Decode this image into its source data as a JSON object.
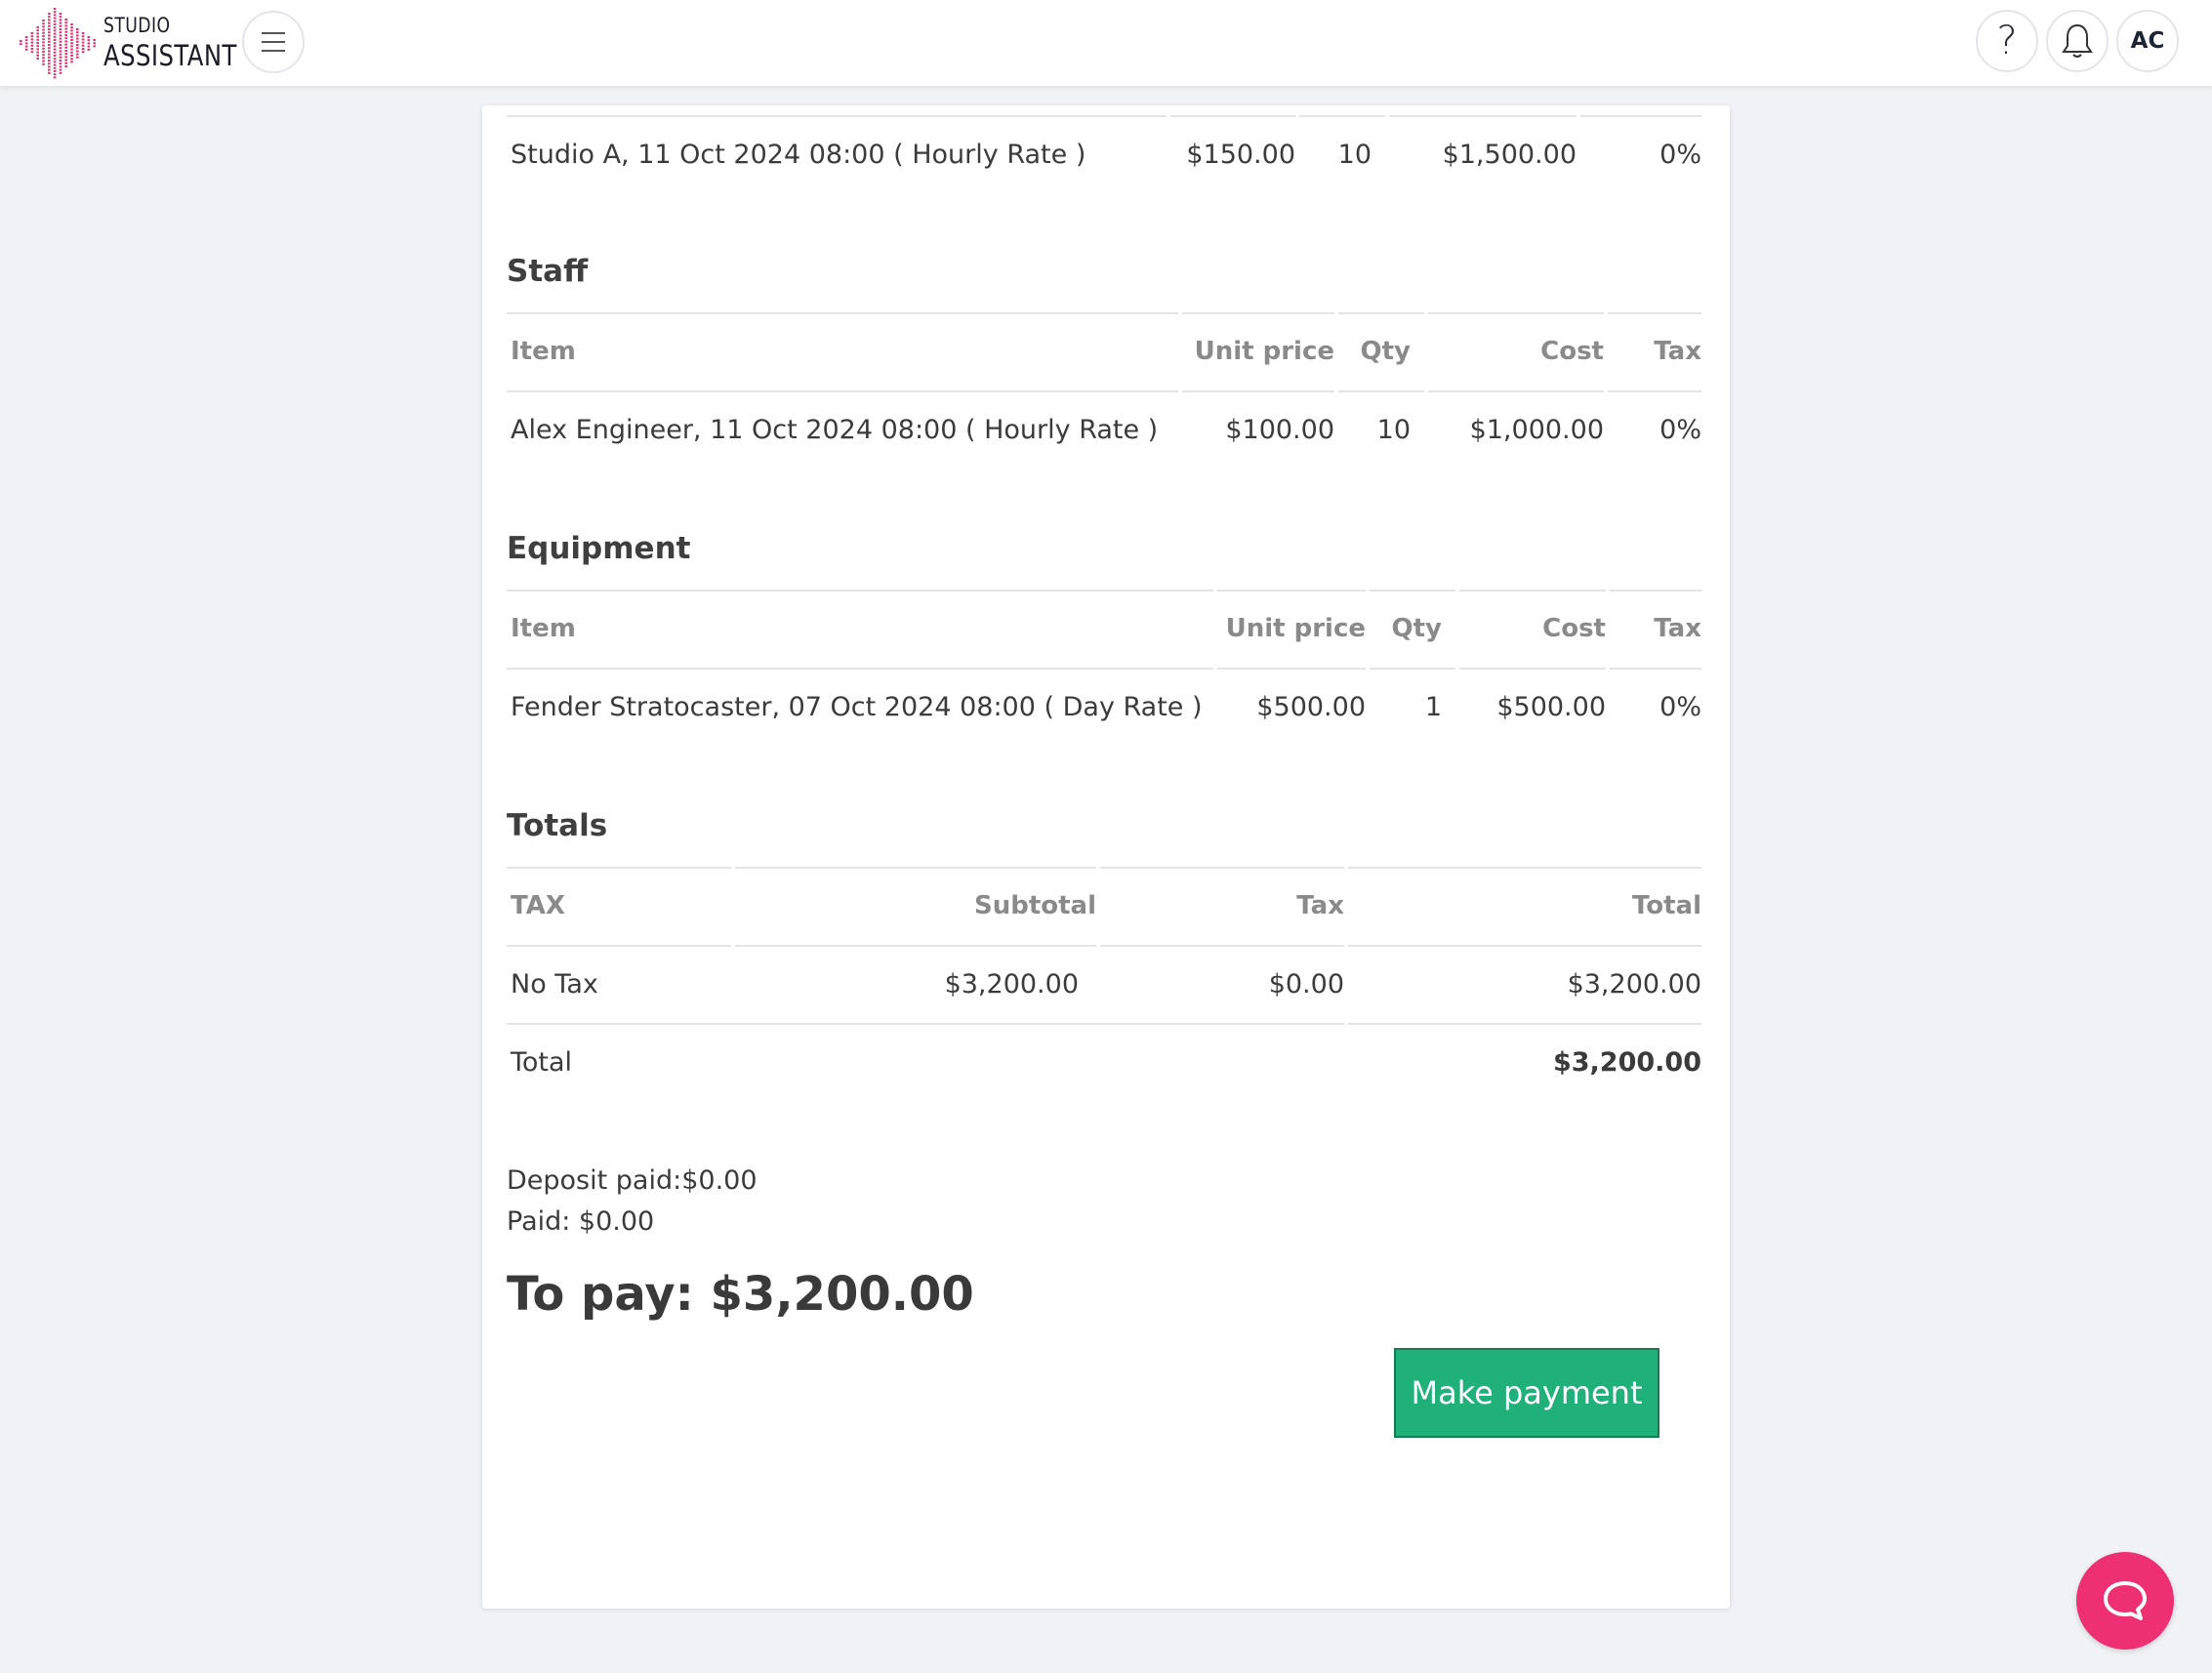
{
  "header": {
    "logo_top": "STUDIO",
    "logo_bottom": "ASSISTANT",
    "help_label": "?",
    "avatar_initials": "AC"
  },
  "rooms": {
    "rows": [
      {
        "item": "Studio A, 11 Oct 2024 08:00 ( Hourly Rate )",
        "unit_price": "$150.00",
        "qty": "10",
        "cost": "$1,500.00",
        "tax": "0%"
      }
    ]
  },
  "staff": {
    "title": "Staff",
    "headers": {
      "item": "Item",
      "unit_price": "Unit price",
      "qty": "Qty",
      "cost": "Cost",
      "tax": "Tax"
    },
    "rows": [
      {
        "item": "Alex Engineer, 11 Oct 2024 08:00 ( Hourly Rate )",
        "unit_price": "$100.00",
        "qty": "10",
        "cost": "$1,000.00",
        "tax": "0%"
      }
    ]
  },
  "equipment": {
    "title": "Equipment",
    "headers": {
      "item": "Item",
      "unit_price": "Unit price",
      "qty": "Qty",
      "cost": "Cost",
      "tax": "Tax"
    },
    "rows": [
      {
        "item": "Fender Stratocaster, 07 Oct 2024 08:00 ( Day Rate )",
        "unit_price": "$500.00",
        "qty": "1",
        "cost": "$500.00",
        "tax": "0%"
      }
    ]
  },
  "totals": {
    "title": "Totals",
    "headers": {
      "tax": "TAX",
      "subtotal": "Subtotal",
      "tax_amount": "Tax",
      "total": "Total"
    },
    "rows": [
      {
        "tax": "No Tax",
        "subtotal": "$3,200.00",
        "tax_amount": "$0.00",
        "total": "$3,200.00"
      }
    ],
    "grand_label": "Total",
    "grand_value": "$3,200.00"
  },
  "summary": {
    "deposit_paid": "Deposit paid:$0.00",
    "paid": "Paid: $0.00",
    "to_pay": "To pay: $3,200.00"
  },
  "actions": {
    "make_payment": "Make payment"
  },
  "colors": {
    "accent_green": "#20b07a",
    "chat_pink": "#ee2f74",
    "logo_pink": "#e0336f"
  }
}
